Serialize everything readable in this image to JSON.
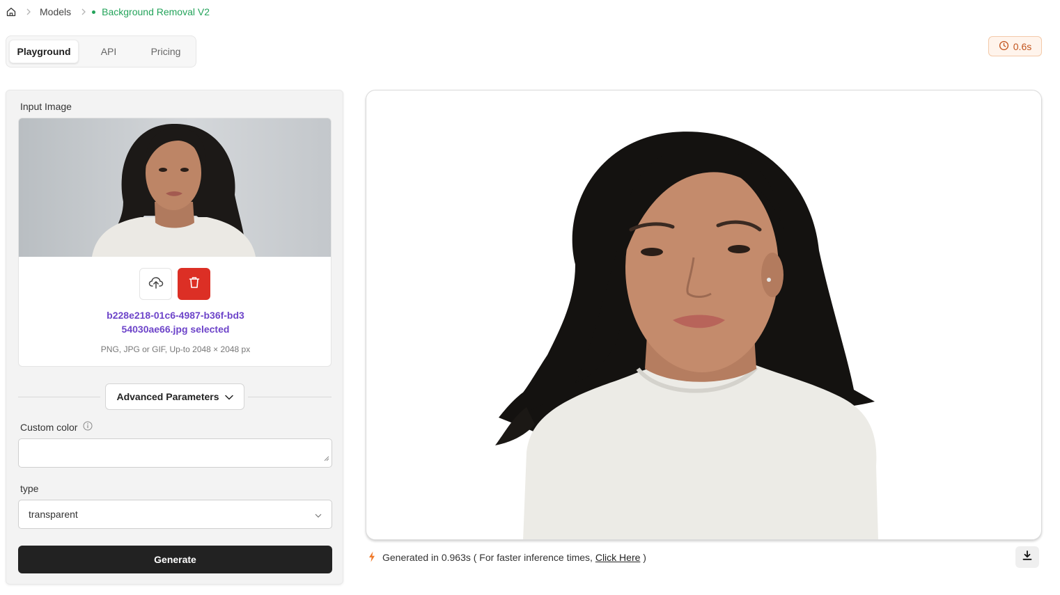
{
  "breadcrumb": {
    "home_icon": "home-icon",
    "models": "Models",
    "current": "Background Removal V2",
    "current_color": "#23a35a"
  },
  "tabs": [
    {
      "label": "Playground",
      "active": true
    },
    {
      "label": "API",
      "active": false
    },
    {
      "label": "Pricing",
      "active": false
    }
  ],
  "timing_badge": {
    "icon": "clock-icon",
    "value": "0.6s",
    "color": "#c2531c"
  },
  "input": {
    "label": "Input Image",
    "filename_selected": "b228e218-01c6-4987-b36f-bd354030ae66.jpg selected",
    "hint": "PNG, JPG or GIF, Up-to 2048 × 2048 px",
    "upload_icon": "cloud-upload-icon",
    "delete_icon": "trash-icon",
    "delete_color": "#dc2f25"
  },
  "advanced": {
    "label": "Advanced Parameters",
    "icon": "chevron-down-icon"
  },
  "custom_color": {
    "label": "Custom color",
    "info_icon": "info-icon",
    "value": ""
  },
  "type_field": {
    "label": "type",
    "value": "transparent"
  },
  "generate": {
    "label": "Generate"
  },
  "output": {
    "status_icon": "lightning-icon",
    "status_text": "Generated in 0.963s ( For faster inference times,",
    "link_text": "Click Here",
    "close_paren": ")",
    "download_icon": "download-icon"
  },
  "accent_colors": {
    "link_purple": "#6d44c9",
    "generate_bg": "#222222",
    "lightning": "#f07a2a"
  }
}
